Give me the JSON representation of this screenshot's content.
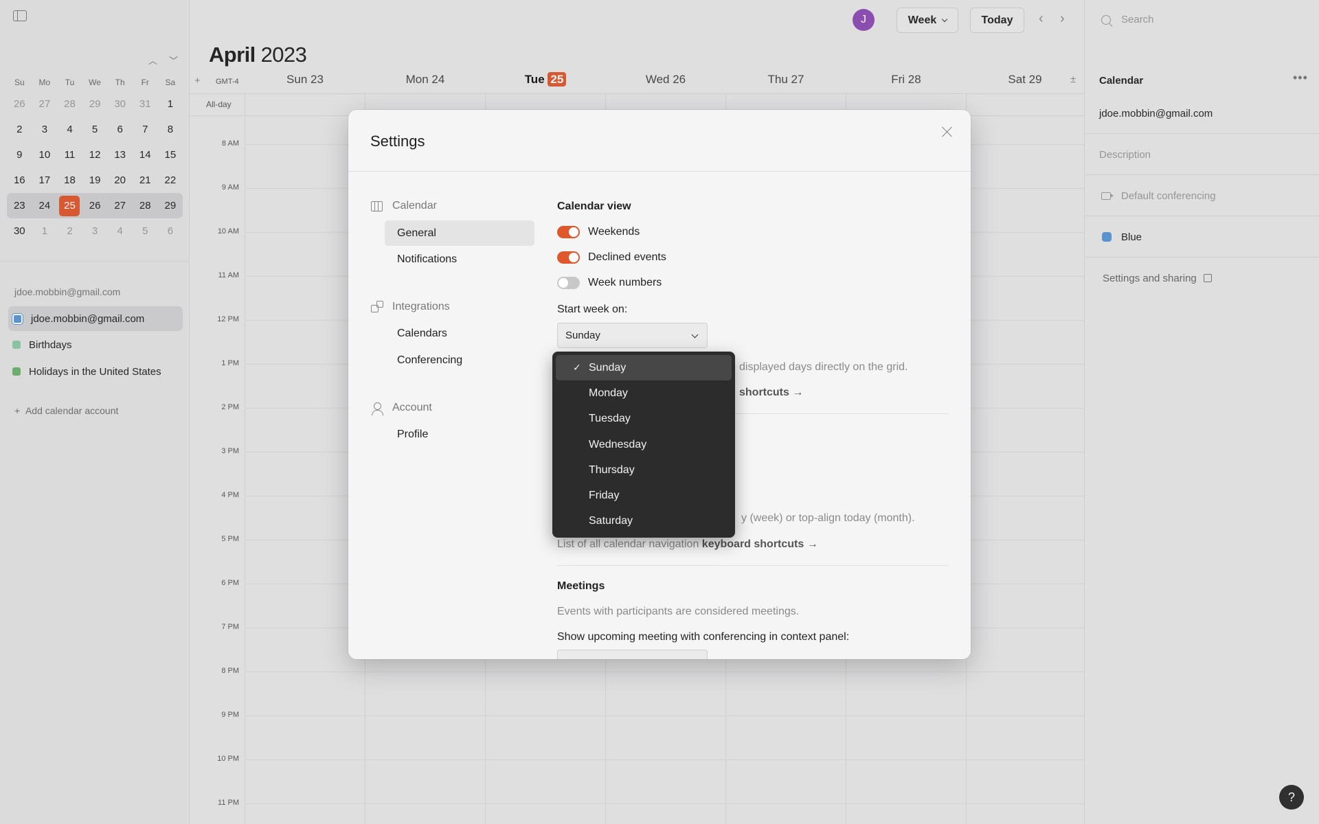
{
  "sidebar": {
    "weekday_heads": [
      "Su",
      "Mo",
      "Tu",
      "We",
      "Th",
      "Fr",
      "Sa"
    ],
    "weeks": [
      [
        "26",
        "27",
        "28",
        "29",
        "30",
        "31",
        "1"
      ],
      [
        "2",
        "3",
        "4",
        "5",
        "6",
        "7",
        "8"
      ],
      [
        "9",
        "10",
        "11",
        "12",
        "13",
        "14",
        "15"
      ],
      [
        "16",
        "17",
        "18",
        "19",
        "20",
        "21",
        "22"
      ],
      [
        "23",
        "24",
        "25",
        "26",
        "27",
        "28",
        "29"
      ],
      [
        "30",
        "1",
        "2",
        "3",
        "4",
        "5",
        "6"
      ]
    ],
    "account_label": "jdoe.mobbin@gmail.com",
    "calendars": [
      {
        "label": "jdoe.mobbin@gmail.com",
        "color": "#5a96d4"
      },
      {
        "label": "Birthdays",
        "color": "#8fc9a6"
      },
      {
        "label": "Holidays in the United States",
        "color": "#6cb36d"
      }
    ],
    "add_account": "Add calendar account"
  },
  "topbar": {
    "avatar": "J",
    "view": "Week",
    "today": "Today"
  },
  "calendar": {
    "month": "April",
    "year": "2023",
    "timezone": "GMT-4",
    "allday": "All-day",
    "today_label": "Tue",
    "today_num": "25",
    "days": [
      "Sun 23",
      "Mon 24",
      "Tue 25",
      "Wed 26",
      "Thu 27",
      "Fri 28",
      "Sat 29"
    ],
    "hours": [
      "8 AM",
      "9 AM",
      "10 AM",
      "11 AM",
      "12 PM",
      "1 PM",
      "2 PM",
      "3 PM",
      "4 PM",
      "5 PM",
      "6 PM",
      "7 PM",
      "8 PM",
      "9 PM",
      "10 PM",
      "11 PM"
    ]
  },
  "right_panel": {
    "search_placeholder": "Search",
    "title": "Calendar",
    "email": "jdoe.mobbin@gmail.com",
    "description": "Description",
    "conferencing": "Default conferencing",
    "color_name": "Blue",
    "settings_link": "Settings and sharing"
  },
  "settings": {
    "title": "Settings",
    "nav": {
      "calendar_group": "Calendar",
      "general": "General",
      "notifications": "Notifications",
      "integrations_group": "Integrations",
      "calendars": "Calendars",
      "conferencing": "Conferencing",
      "account_group": "Account",
      "profile": "Profile"
    },
    "calendar_view": {
      "title": "Calendar view",
      "weekends": "Weekends",
      "declined": "Declined events",
      "week_numbers": "Week numbers",
      "weekends_on": true,
      "declined_on": true,
      "week_numbers_on": false,
      "start_week_label": "Start week on:",
      "start_week_value": "Sunday",
      "grid_hint": "displayed days directly on the grid.",
      "shortcuts_hint": "shortcuts →",
      "align_hint": "y (week) or top-align today (month).",
      "nav_list_pre": "List of all calendar navigation ",
      "nav_list_link": "keyboard shortcuts →"
    },
    "meetings": {
      "title": "Meetings",
      "desc": "Events with participants are considered meetings.",
      "upcoming_label": "Show upcoming meeting with conferencing in context panel:"
    },
    "dropdown": {
      "options": [
        "Sunday",
        "Monday",
        "Tuesday",
        "Wednesday",
        "Thursday",
        "Friday",
        "Saturday"
      ],
      "selected": "Sunday",
      "check": "✓"
    }
  },
  "help": "?"
}
